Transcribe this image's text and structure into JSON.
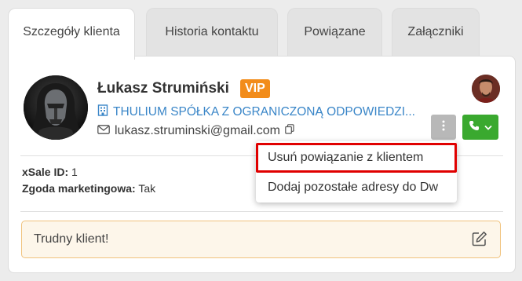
{
  "tabs": [
    {
      "label": "Szczegóły klienta",
      "active": true
    },
    {
      "label": "Historia kontaktu",
      "active": false
    },
    {
      "label": "Powiązane",
      "active": false
    },
    {
      "label": "Załączniki",
      "active": false
    }
  ],
  "client": {
    "name": "Łukasz Strumiński",
    "badge": "VIP",
    "company": "THULIUM SPÓŁKA Z OGRANICZONĄ ODPOWIEDZI...",
    "email": "lukasz.struminski@gmail.com"
  },
  "fields": {
    "xsale_label": "xSale ID:",
    "xsale_value": "1",
    "consent_label": "Zgoda marketingowa:",
    "consent_value": "Tak"
  },
  "note": {
    "text": "Trudny klient!"
  },
  "dropdown": {
    "items": [
      {
        "label": "Usuń powiązanie z klientem",
        "highlighted": true
      },
      {
        "label": "Dodaj pozostałe adresy do Dw",
        "highlighted": false
      }
    ]
  },
  "icons": {
    "company": "building-icon",
    "email": "envelope-icon",
    "copy": "copy-icon",
    "more": "more-vertical-icon",
    "call": "phone-icon",
    "chevron": "chevron-down-icon",
    "edit": "edit-icon"
  },
  "colors": {
    "vip_badge": "#f28c1a",
    "link": "#3a86c8",
    "call_button": "#3aa92f",
    "highlight": "#e00000",
    "note_border": "#f0c27d",
    "note_bg": "#fdf6ea"
  }
}
